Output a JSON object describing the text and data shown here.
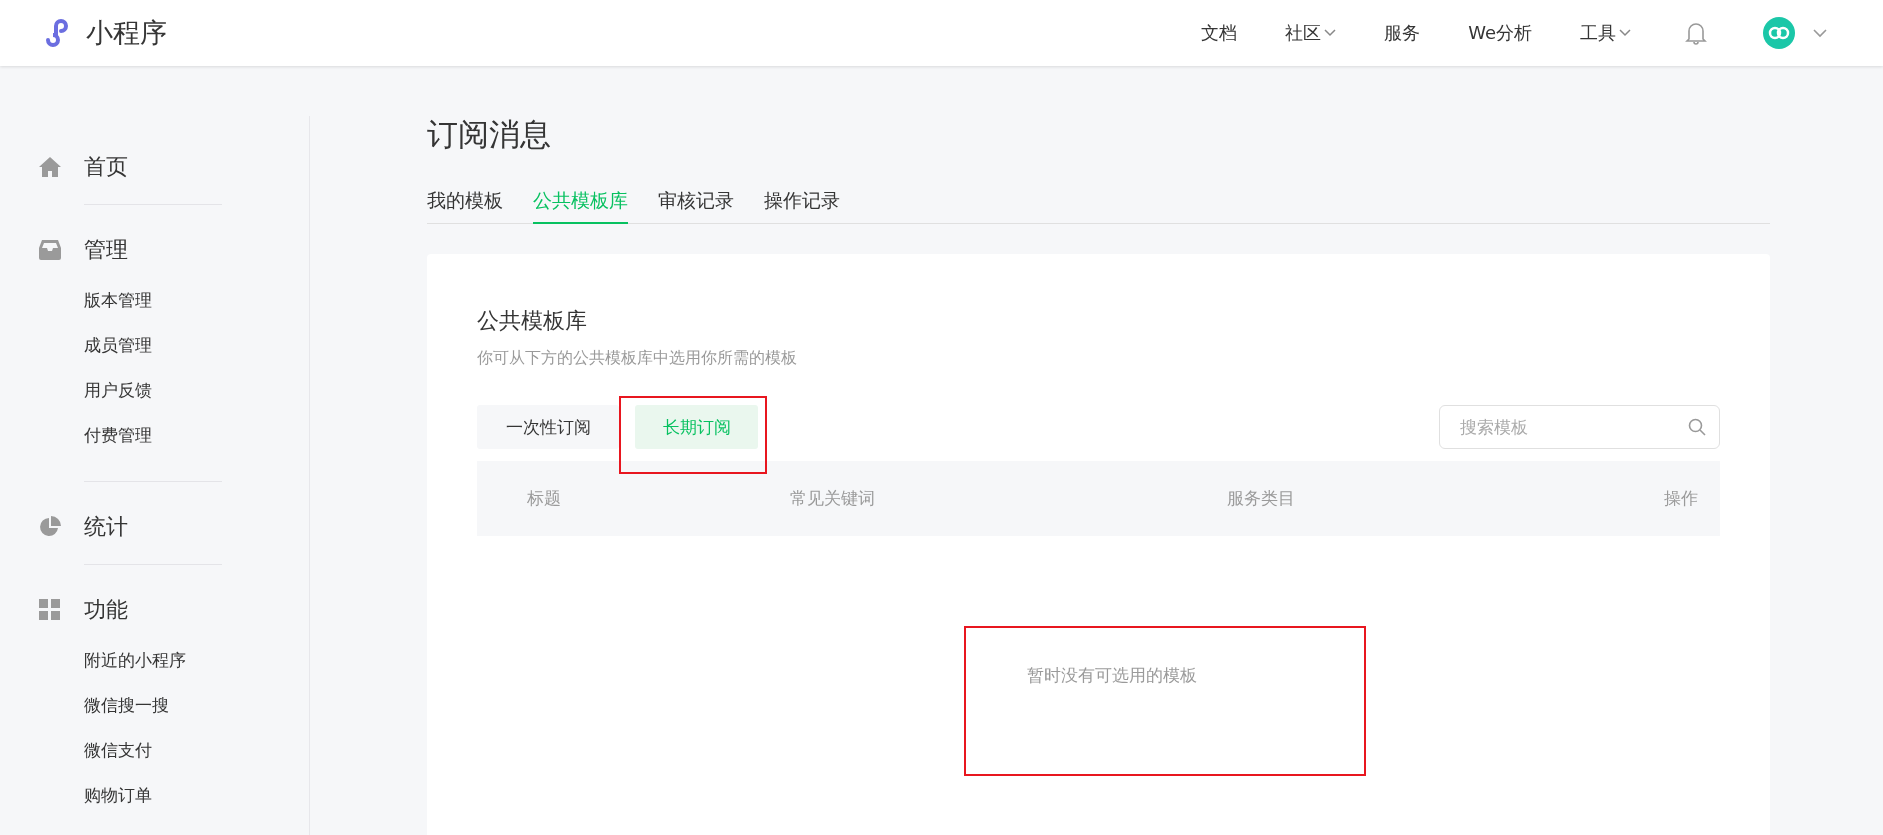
{
  "header": {
    "logo_text": "小程序",
    "nav": [
      {
        "label": "文档",
        "dropdown": false
      },
      {
        "label": "社区",
        "dropdown": true
      },
      {
        "label": "服务",
        "dropdown": false
      },
      {
        "label": "We分析",
        "dropdown": false
      },
      {
        "label": "工具",
        "dropdown": true
      }
    ]
  },
  "sidebar": {
    "groups": [
      {
        "kind": "home",
        "label": "首页"
      },
      {
        "kind": "manage",
        "label": "管理",
        "items": [
          "版本管理",
          "成员管理",
          "用户反馈",
          "付费管理"
        ]
      },
      {
        "kind": "stats",
        "label": "统计"
      },
      {
        "kind": "features",
        "label": "功能",
        "items": [
          "附近的小程序",
          "微信搜一搜",
          "微信支付",
          "购物订单"
        ]
      }
    ]
  },
  "page": {
    "title": "订阅消息",
    "tabs": [
      {
        "label": "我的模板",
        "selected": false
      },
      {
        "label": "公共模板库",
        "selected": true
      },
      {
        "label": "审核记录",
        "selected": false
      },
      {
        "label": "操作记录",
        "selected": false
      }
    ]
  },
  "card": {
    "title": "公共模板库",
    "description": "你可从下方的公共模板库中选用你所需的模板",
    "sub_tabs": [
      {
        "label": "一次性订阅",
        "selected": false,
        "highlighted": false
      },
      {
        "label": "长期订阅",
        "selected": true,
        "highlighted": true
      }
    ],
    "search": {
      "placeholder": "搜索模板"
    },
    "table": {
      "columns": [
        "标题",
        "常见关键词",
        "服务类目",
        "操作"
      ],
      "empty_text": "暂时没有可选用的模板",
      "empty_highlighted": true
    }
  }
}
